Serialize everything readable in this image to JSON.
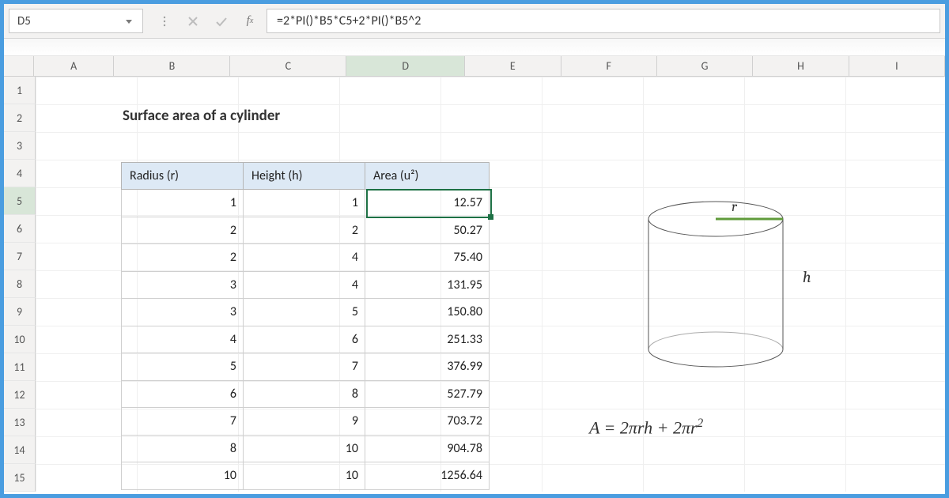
{
  "formula_bar": {
    "active_cell": "D5",
    "formula": "=2*PI()*B5*C5+2*PI()*B5^2"
  },
  "columns": [
    "A",
    "B",
    "C",
    "D",
    "E",
    "F",
    "G",
    "H",
    "I"
  ],
  "active_col_index": 3,
  "row_labels": [
    "1",
    "2",
    "3",
    "4",
    "5",
    "6",
    "7",
    "8",
    "9",
    "10",
    "11",
    "12",
    "13",
    "14",
    "15"
  ],
  "active_row_index": 4,
  "title": "Surface area of a cylinder",
  "headers": {
    "radius": "Radius (r)",
    "height": "Height (h)",
    "area": "Area (u²)"
  },
  "rows": [
    {
      "r": "1",
      "h": "1",
      "area": "12.57"
    },
    {
      "r": "2",
      "h": "2",
      "area": "50.27"
    },
    {
      "r": "2",
      "h": "4",
      "area": "75.40"
    },
    {
      "r": "3",
      "h": "4",
      "area": "131.95"
    },
    {
      "r": "3",
      "h": "5",
      "area": "150.80"
    },
    {
      "r": "4",
      "h": "6",
      "area": "251.33"
    },
    {
      "r": "5",
      "h": "7",
      "area": "376.99"
    },
    {
      "r": "6",
      "h": "8",
      "area": "527.79"
    },
    {
      "r": "7",
      "h": "9",
      "area": "703.72"
    },
    {
      "r": "8",
      "h": "10",
      "area": "904.78"
    },
    {
      "r": "10",
      "h": "10",
      "area": "1256.64"
    }
  ],
  "diagram": {
    "r_label": "r",
    "h_label": "h"
  },
  "math_formula": "A = 2πrh + 2πr²",
  "chart_data": {
    "type": "table",
    "title": "Surface area of a cylinder",
    "columns": [
      "Radius (r)",
      "Height (h)",
      "Area (u²)"
    ],
    "data": [
      [
        1,
        1,
        12.57
      ],
      [
        2,
        2,
        50.27
      ],
      [
        2,
        4,
        75.4
      ],
      [
        3,
        4,
        131.95
      ],
      [
        3,
        5,
        150.8
      ],
      [
        4,
        6,
        251.33
      ],
      [
        5,
        7,
        376.99
      ],
      [
        6,
        8,
        527.79
      ],
      [
        7,
        9,
        703.72
      ],
      [
        8,
        10,
        904.78
      ],
      [
        10,
        10,
        1256.64
      ]
    ],
    "formula": "A = 2πrh + 2πr²"
  }
}
